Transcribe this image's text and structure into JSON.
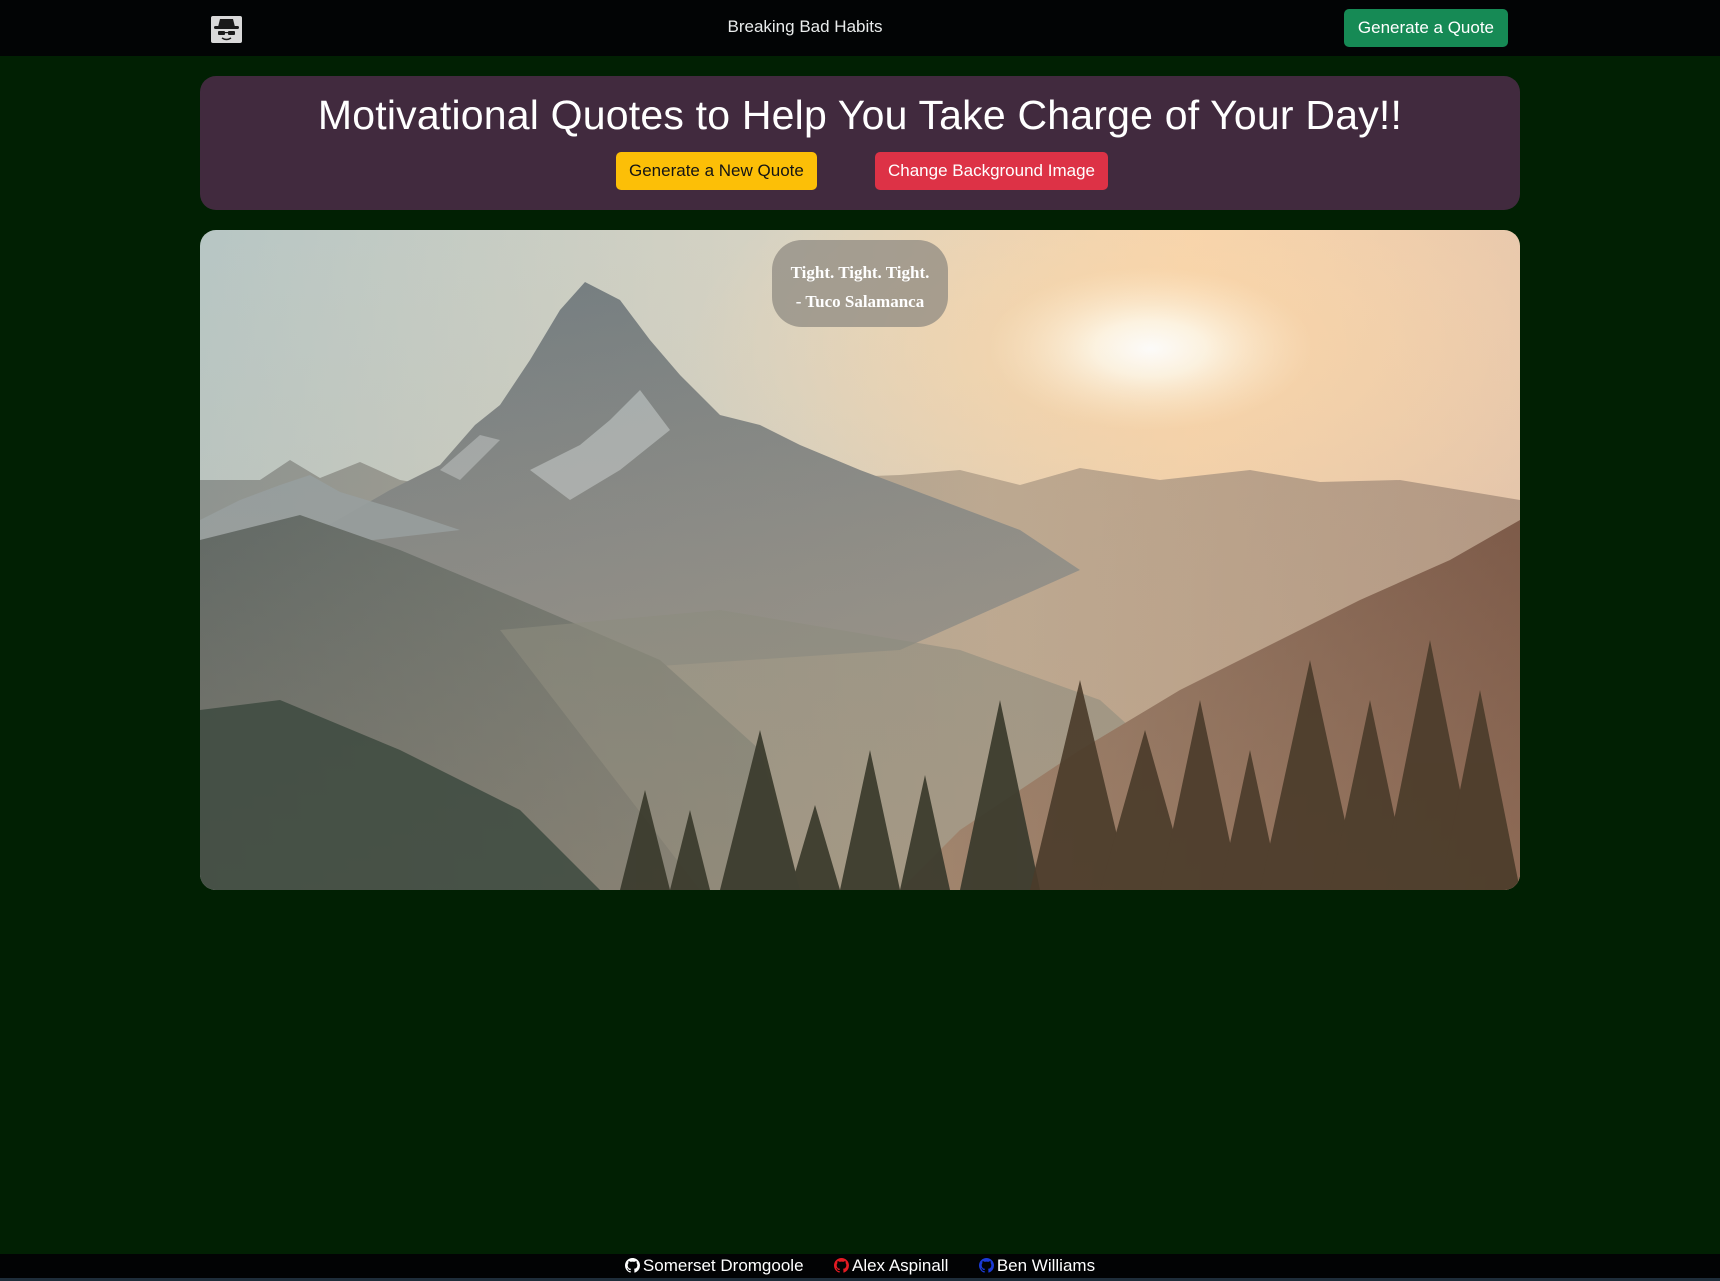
{
  "navbar": {
    "logo_icon": "heisenberg-logo-icon",
    "title": "Breaking Bad Habits",
    "cta_label": "Generate a Quote",
    "cta_color": "#168a55"
  },
  "header": {
    "headline": "Motivational Quotes to Help You Take Charge of Your Day!!",
    "generate_label": "Generate a New Quote",
    "change_bg_label": "Change Background Image",
    "panel_color": "#412a3e",
    "generate_color": "#fcbf07",
    "change_bg_color": "#dd3246"
  },
  "quote": {
    "text": "Tight. Tight. Tight.",
    "author": "- Tuco Salamanca"
  },
  "background_image": {
    "subject": "mountain peak at sunrise with pine forest"
  },
  "footer": {
    "links": [
      {
        "name": "Somerset Dromgoole",
        "icon": "github-icon",
        "color": "#ffffff"
      },
      {
        "name": "Alex Aspinall",
        "icon": "github-icon",
        "color": "#e31b23"
      },
      {
        "name": "Ben Williams",
        "icon": "github-icon",
        "color": "#1a3ad6"
      }
    ]
  },
  "page_background": "#012003"
}
